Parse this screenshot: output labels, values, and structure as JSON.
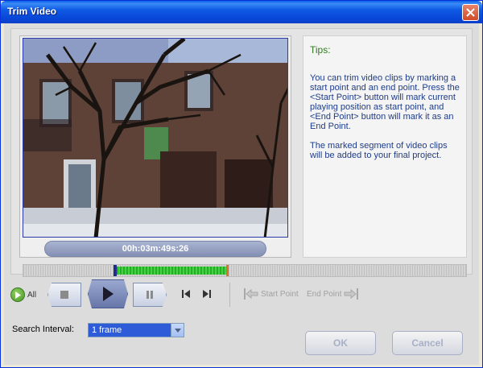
{
  "window": {
    "title": "Trim Video"
  },
  "video": {
    "timecode": "00h:03m:49s:26"
  },
  "tips": {
    "title": "Tips:",
    "paragraph1": "You can trim video clips by marking a start point and an end point. Press the <Start Point> button will mark current playing position as start point, and <End Point> button will mark it as an End Point.",
    "paragraph2": "The marked segment of video clips will be added to your final project."
  },
  "timeline": {
    "selection_start_fraction": 0.21,
    "selection_end_fraction": 0.46
  },
  "controls": {
    "all_label": "All",
    "start_point_label": "Start Point",
    "end_point_label": "End Point"
  },
  "search": {
    "label": "Search Interval:",
    "value": "1 frame"
  },
  "buttons": {
    "ok": "OK",
    "cancel": "Cancel"
  },
  "colors": {
    "title_bar": "#0845D6",
    "tips_title": "#2E7A1E",
    "tips_text": "#1E3C8A",
    "selection": "#22B022"
  }
}
